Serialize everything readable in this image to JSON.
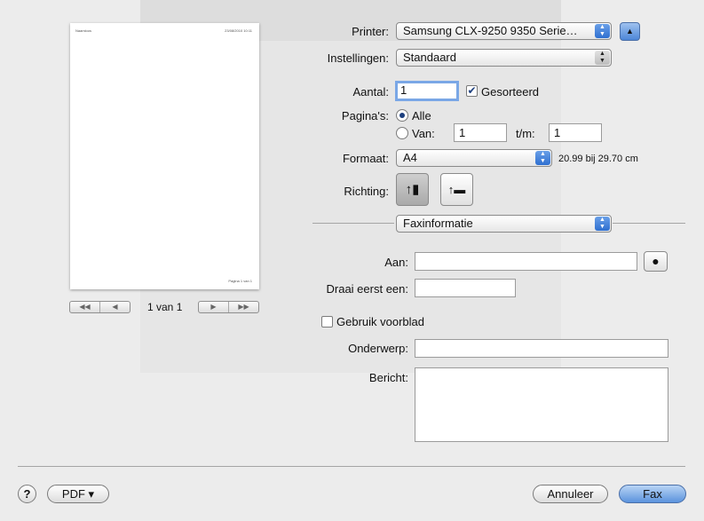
{
  "preview": {
    "header_left": "Naamloos",
    "header_right": "23/08/2010 10:11",
    "footer": "Pagina 1 van 1",
    "page_indicator": "1 van 1"
  },
  "printer": {
    "label": "Printer:",
    "value": "Samsung CLX-9250 9350 Serie…"
  },
  "settings": {
    "label": "Instellingen:",
    "value": "Standaard"
  },
  "copies": {
    "label": "Aantal:",
    "value": "1",
    "collate_label": "Gesorteerd",
    "collate_checked": true
  },
  "pages": {
    "label": "Pagina's:",
    "all_label": "Alle",
    "from_label": "Van:",
    "from_value": "1",
    "to_label": "t/m:",
    "to_value": "1"
  },
  "format": {
    "label": "Formaat:",
    "value": "A4",
    "size_text": "20.99 bij 29.70 cm"
  },
  "orientation": {
    "label": "Richting:"
  },
  "section": {
    "value": "Faxinformatie"
  },
  "fax": {
    "to_label": "Aan:",
    "to_value": "",
    "dial_label": "Draai eerst een:",
    "dial_value": "",
    "cover_label": "Gebruik voorblad",
    "subject_label": "Onderwerp:",
    "subject_value": "",
    "message_label": "Bericht:",
    "message_value": ""
  },
  "footer": {
    "help_label": "?",
    "pdf_label": "PDF ▾",
    "cancel_label": "Annuleer",
    "fax_label": "Fax"
  }
}
